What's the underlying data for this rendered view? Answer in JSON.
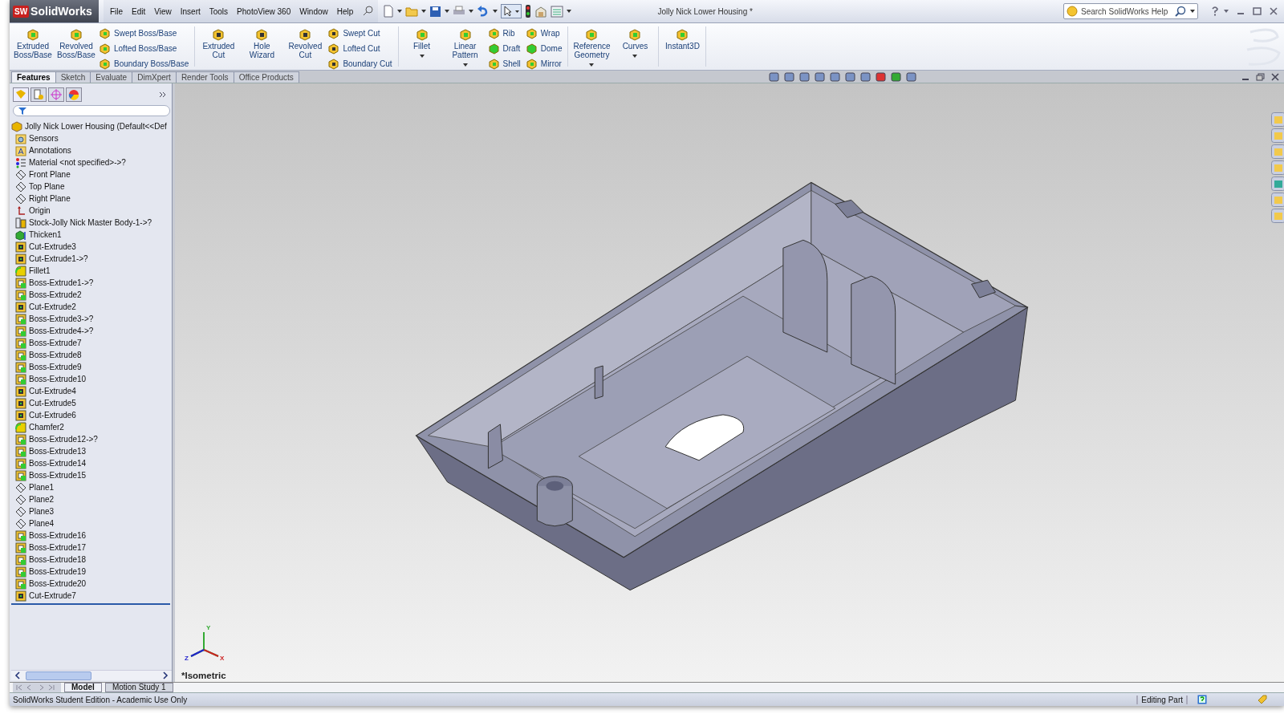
{
  "app": {
    "logo_badge": "SW",
    "logo": "SolidWorks",
    "menus": [
      "File",
      "Edit",
      "View",
      "Insert",
      "Tools",
      "PhotoView 360",
      "Window",
      "Help"
    ],
    "document_title": "Jolly Nick Lower Housing *",
    "search": {
      "placeholder": "Search SolidWorks Help"
    }
  },
  "ribbon": {
    "groups": [
      {
        "columns": [
          {
            "kind": "large",
            "label": "Extruded Boss/Base"
          },
          {
            "kind": "large",
            "label": "Revolved Boss/Base"
          },
          {
            "kind": "stack",
            "items": [
              "Swept Boss/Base",
              "Lofted Boss/Base",
              "Boundary Boss/Base"
            ]
          }
        ]
      },
      {
        "columns": [
          {
            "kind": "large",
            "label": "Extruded Cut"
          },
          {
            "kind": "large",
            "label": "Hole Wizard"
          },
          {
            "kind": "large",
            "label": "Revolved Cut"
          },
          {
            "kind": "stack",
            "items": [
              "Swept Cut",
              "Lofted Cut",
              "Boundary Cut"
            ]
          }
        ]
      },
      {
        "columns": [
          {
            "kind": "large",
            "label": "Fillet",
            "dropdown": true
          },
          {
            "kind": "large",
            "label": "Linear Pattern",
            "dropdown": true
          },
          {
            "kind": "stack",
            "items": [
              "Rib",
              "Draft",
              "Shell"
            ]
          },
          {
            "kind": "stack",
            "items": [
              "Wrap",
              "Dome",
              "Mirror"
            ]
          }
        ]
      },
      {
        "columns": [
          {
            "kind": "large",
            "label": "Reference Geometry",
            "dropdown": true
          },
          {
            "kind": "large",
            "label": "Curves",
            "dropdown": true
          }
        ]
      },
      {
        "columns": [
          {
            "kind": "large",
            "label": "Instant3D"
          }
        ]
      }
    ]
  },
  "command_tabs": [
    {
      "label": "Features",
      "selected": true
    },
    {
      "label": "Sketch",
      "selected": false
    },
    {
      "label": "Evaluate",
      "selected": false
    },
    {
      "label": "DimXpert",
      "selected": false
    },
    {
      "label": "Render Tools",
      "selected": false
    },
    {
      "label": "Office Products",
      "selected": false
    }
  ],
  "feature_tree": {
    "items": [
      {
        "label": "Jolly Nick Lower Housing (Default<<Def",
        "kind": "part"
      },
      {
        "label": "Sensors",
        "kind": "sensors"
      },
      {
        "label": "Annotations",
        "kind": "annotations"
      },
      {
        "label": "Material <not specified>->?",
        "kind": "material"
      },
      {
        "label": "Front Plane",
        "kind": "plane"
      },
      {
        "label": "Top Plane",
        "kind": "plane"
      },
      {
        "label": "Right Plane",
        "kind": "plane"
      },
      {
        "label": "Origin",
        "kind": "origin"
      },
      {
        "label": "Stock-Jolly Nick Master Body-1->?",
        "kind": "stock"
      },
      {
        "label": "Thicken1",
        "kind": "thicken"
      },
      {
        "label": "Cut-Extrude3",
        "kind": "cut"
      },
      {
        "label": "Cut-Extrude1->?",
        "kind": "cut"
      },
      {
        "label": "Fillet1",
        "kind": "fillet"
      },
      {
        "label": "Boss-Extrude1->?",
        "kind": "boss"
      },
      {
        "label": "Boss-Extrude2",
        "kind": "boss"
      },
      {
        "label": "Cut-Extrude2",
        "kind": "cut"
      },
      {
        "label": "Boss-Extrude3->?",
        "kind": "boss"
      },
      {
        "label": "Boss-Extrude4->?",
        "kind": "boss"
      },
      {
        "label": "Boss-Extrude7",
        "kind": "boss"
      },
      {
        "label": "Boss-Extrude8",
        "kind": "boss"
      },
      {
        "label": "Boss-Extrude9",
        "kind": "boss"
      },
      {
        "label": "Boss-Extrude10",
        "kind": "boss"
      },
      {
        "label": "Cut-Extrude4",
        "kind": "cut"
      },
      {
        "label": "Cut-Extrude5",
        "kind": "cut"
      },
      {
        "label": "Cut-Extrude6",
        "kind": "cut"
      },
      {
        "label": "Chamfer2",
        "kind": "fillet"
      },
      {
        "label": "Boss-Extrude12->?",
        "kind": "boss"
      },
      {
        "label": "Boss-Extrude13",
        "kind": "boss"
      },
      {
        "label": "Boss-Extrude14",
        "kind": "boss"
      },
      {
        "label": "Boss-Extrude15",
        "kind": "boss"
      },
      {
        "label": "Plane1",
        "kind": "plane"
      },
      {
        "label": "Plane2",
        "kind": "plane"
      },
      {
        "label": "Plane3",
        "kind": "plane"
      },
      {
        "label": "Plane4",
        "kind": "plane"
      },
      {
        "label": "Boss-Extrude16",
        "kind": "boss"
      },
      {
        "label": "Boss-Extrude17",
        "kind": "boss"
      },
      {
        "label": "Boss-Extrude18",
        "kind": "boss"
      },
      {
        "label": "Boss-Extrude19",
        "kind": "boss"
      },
      {
        "label": "Boss-Extrude20",
        "kind": "boss"
      },
      {
        "label": "Cut-Extrude7",
        "kind": "cut"
      }
    ]
  },
  "viewport": {
    "view_name": "*Isometric",
    "triad": {
      "x": "X",
      "y": "Y",
      "z": "Z"
    }
  },
  "bottom_tabs": [
    {
      "label": "Model",
      "selected": true
    },
    {
      "label": "Motion Study 1",
      "selected": false
    }
  ],
  "status_bar": {
    "edition": "SolidWorks Student Edition - Academic Use Only",
    "mode": "Editing Part"
  }
}
